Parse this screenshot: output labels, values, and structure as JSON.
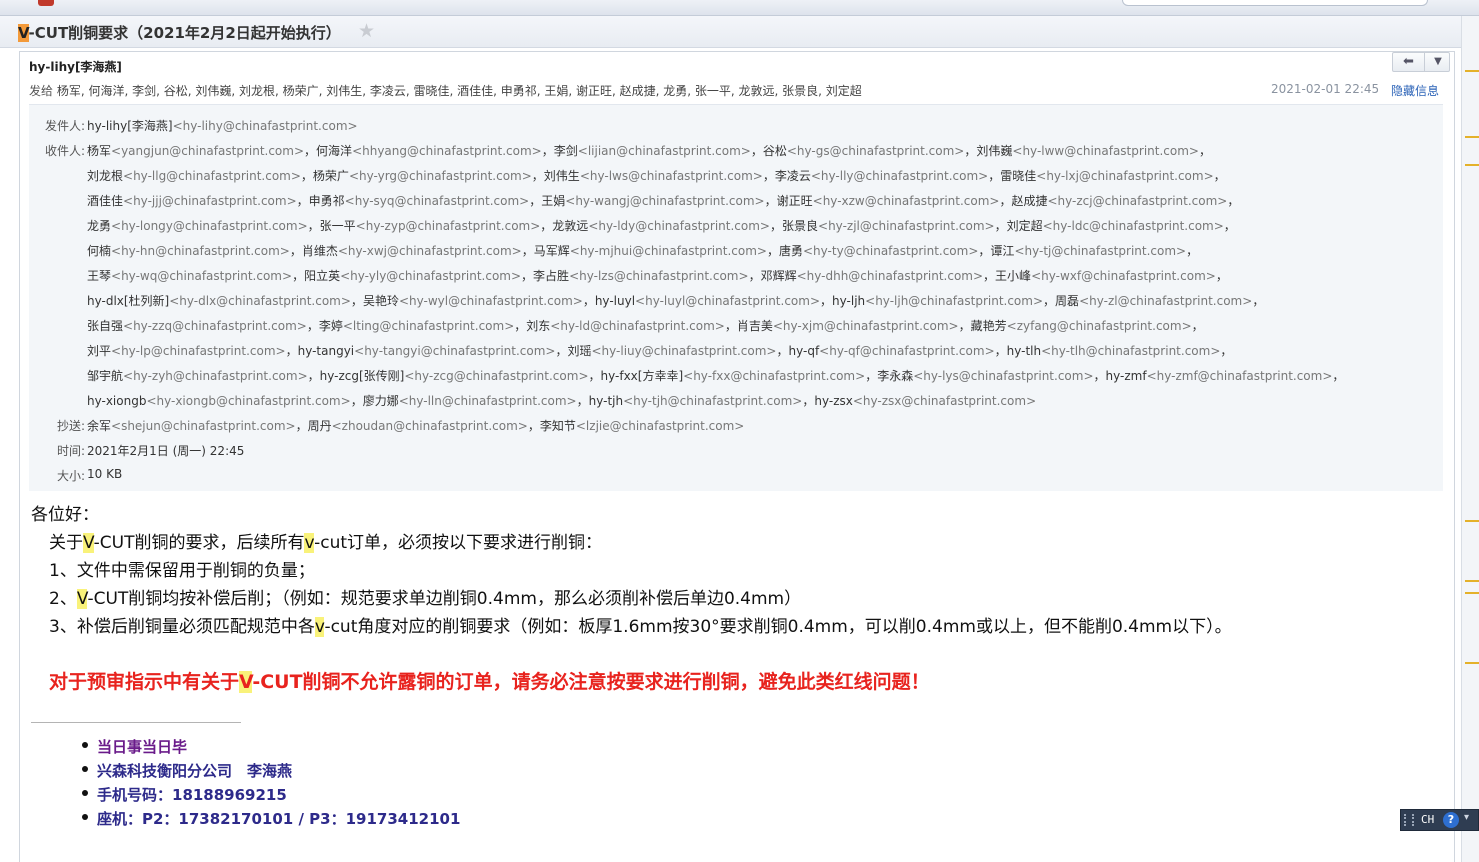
{
  "subject": {
    "highlight": "V",
    "rest": "-CUT削铜要求（2021年2月2日起开始执行）"
  },
  "header": {
    "sender": "hy-lihy[李海燕]",
    "send_to_label": "发给",
    "send_to": "杨军, 何海洋, 李剑, 谷松, 刘伟巍, 刘龙根, 杨荣广, 刘伟生, 李凌云, 雷晓佳, 酒佳佳, 申勇祁, 王娟, 谢正旺, 赵成捷, 龙勇, 张一平, 龙敦远, 张景良, 刘定超",
    "datetime": "2021-02-01 22:45",
    "hide_link": "隐藏信息"
  },
  "details": {
    "from_label": "发件人:",
    "from_name": "hy-lihy[李海燕]",
    "from_addr": "<hy-lihy@chinafastprint.com>",
    "to_label": "收件人:",
    "to_lines": [
      [
        [
          "杨军",
          "<yangjun@chinafastprint.com>"
        ],
        [
          "何海洋",
          "<hhyang@chinafastprint.com>"
        ],
        [
          "李剑",
          "<lijian@chinafastprint.com>"
        ],
        [
          "谷松",
          "<hy-gs@chinafastprint.com>"
        ],
        [
          "刘伟巍",
          "<hy-lww@chinafastprint.com>"
        ]
      ],
      [
        [
          "刘龙根",
          "<hy-llg@chinafastprint.com>"
        ],
        [
          "杨荣广",
          "<hy-yrg@chinafastprint.com>"
        ],
        [
          "刘伟生",
          "<hy-lws@chinafastprint.com>"
        ],
        [
          "李凌云",
          "<hy-lly@chinafastprint.com>"
        ],
        [
          "雷晓佳",
          "<hy-lxj@chinafastprint.com>"
        ]
      ],
      [
        [
          "酒佳佳",
          "<hy-jjj@chinafastprint.com>"
        ],
        [
          "申勇祁",
          "<hy-syq@chinafastprint.com>"
        ],
        [
          "王娟",
          "<hy-wangj@chinafastprint.com>"
        ],
        [
          "谢正旺",
          "<hy-xzw@chinafastprint.com>"
        ],
        [
          "赵成捷",
          "<hy-zcj@chinafastprint.com>"
        ]
      ],
      [
        [
          "龙勇",
          "<hy-longy@chinafastprint.com>"
        ],
        [
          "张一平",
          "<hy-zyp@chinafastprint.com>"
        ],
        [
          "龙敦远",
          "<hy-ldy@chinafastprint.com>"
        ],
        [
          "张景良",
          "<hy-zjl@chinafastprint.com>"
        ],
        [
          "刘定超",
          "<hy-ldc@chinafastprint.com>"
        ]
      ],
      [
        [
          "何楠",
          "<hy-hn@chinafastprint.com>"
        ],
        [
          "肖维杰",
          "<hy-xwj@chinafastprint.com>"
        ],
        [
          "马军辉",
          "<hy-mjhui@chinafastprint.com>"
        ],
        [
          "唐勇",
          "<hy-ty@chinafastprint.com>"
        ],
        [
          "谭江",
          "<hy-tj@chinafastprint.com>"
        ]
      ],
      [
        [
          "王琴",
          "<hy-wq@chinafastprint.com>"
        ],
        [
          "阳立英",
          "<hy-yly@chinafastprint.com>"
        ],
        [
          "李占胜",
          "<hy-lzs@chinafastprint.com>"
        ],
        [
          "邓辉辉",
          "<hy-dhh@chinafastprint.com>"
        ],
        [
          "王小峰",
          "<hy-wxf@chinafastprint.com>"
        ]
      ],
      [
        [
          "hy-dlx[杜列新]",
          "<hy-dlx@chinafastprint.com>"
        ],
        [
          "吴艳玲",
          "<hy-wyl@chinafastprint.com>"
        ],
        [
          "hy-luyl",
          "<hy-luyl@chinafastprint.com>"
        ],
        [
          "hy-ljh",
          "<hy-ljh@chinafastprint.com>"
        ],
        [
          "周磊",
          "<hy-zl@chinafastprint.com>"
        ]
      ],
      [
        [
          "张自强",
          "<hy-zzq@chinafastprint.com>"
        ],
        [
          "李婷",
          "<lting@chinafastprint.com>"
        ],
        [
          "刘东",
          "<hy-ld@chinafastprint.com>"
        ],
        [
          "肖吉美",
          "<hy-xjm@chinafastprint.com>"
        ],
        [
          "藏艳芳",
          "<zyfang@chinafastprint.com>"
        ]
      ],
      [
        [
          "刘平",
          "<hy-lp@chinafastprint.com>"
        ],
        [
          "hy-tangyi",
          "<hy-tangyi@chinafastprint.com>"
        ],
        [
          "刘瑶",
          "<hy-liuy@chinafastprint.com>"
        ],
        [
          "hy-qf",
          "<hy-qf@chinafastprint.com>"
        ],
        [
          "hy-tlh",
          "<hy-tlh@chinafastprint.com>"
        ]
      ],
      [
        [
          "邹宇航",
          "<hy-zyh@chinafastprint.com>"
        ],
        [
          "hy-zcg[张传刚]",
          "<hy-zcg@chinafastprint.com>"
        ],
        [
          "hy-fxx[方幸幸]",
          "<hy-fxx@chinafastprint.com>"
        ],
        [
          "李永森",
          "<hy-lys@chinafastprint.com>"
        ],
        [
          "hy-zmf",
          "<hy-zmf@chinafastprint.com>"
        ]
      ],
      [
        [
          "hy-xiongb",
          "<hy-xiongb@chinafastprint.com>"
        ],
        [
          "廖力娜",
          "<hy-lln@chinafastprint.com>"
        ],
        [
          "hy-tjh",
          "<hy-tjh@chinafastprint.com>"
        ],
        [
          "hy-zsx",
          "<hy-zsx@chinafastprint.com>"
        ]
      ]
    ],
    "cc_label": "抄送:",
    "cc": [
      [
        "余军",
        "<shejun@chinafastprint.com>"
      ],
      [
        "周丹",
        "<zhoudan@chinafastprint.com>"
      ],
      [
        "李知节",
        "<lzjie@chinafastprint.com>"
      ]
    ],
    "time_label": "时间:",
    "time": "2021年2月1日 (周一) 22:45",
    "size_label": "大小:",
    "size": "10 KB"
  },
  "body": {
    "greeting": "各位好：",
    "intro": [
      "关于",
      "V",
      "-CUT削铜的要求，后续所有",
      "v",
      "-cut订单，必须按以下要求进行削铜："
    ],
    "item1": "1、文件中需保留用于削铜的负量；",
    "item2": [
      "2、",
      "V",
      "-CUT削铜均按补偿后削；（例如：规范要求单边削铜0.4mm，那么必须削补偿后单边0.4mm）"
    ],
    "item3": [
      "3、补偿后削铜量必须匹配规范中各",
      "v",
      "-cut角度对应的削铜要求（例如：板厚1.6mm按30°要求削铜0.4mm，可以削0.4mm或以上，但不能削0.4mm以下）。"
    ],
    "warning": [
      "对于预审指示中有关于",
      "V",
      "-CUT削铜不允许露铜的订单，请务必注意按要求进行削铜，避免此类红线问题！"
    ]
  },
  "signature": [
    "当日事当日毕",
    "兴森科技衡阳分公司　李海燕",
    "手机号码：18188969215",
    "座机：P2：17382170101 / P3：19173412101"
  ],
  "ime": {
    "lang": "CH",
    "help": "?"
  },
  "colors": {
    "warning": "#e8231e",
    "highlight": "#f9f27a",
    "subject_highlight": "#f39a3a",
    "signature": "#2d2a8a",
    "link": "#2a62b7"
  }
}
